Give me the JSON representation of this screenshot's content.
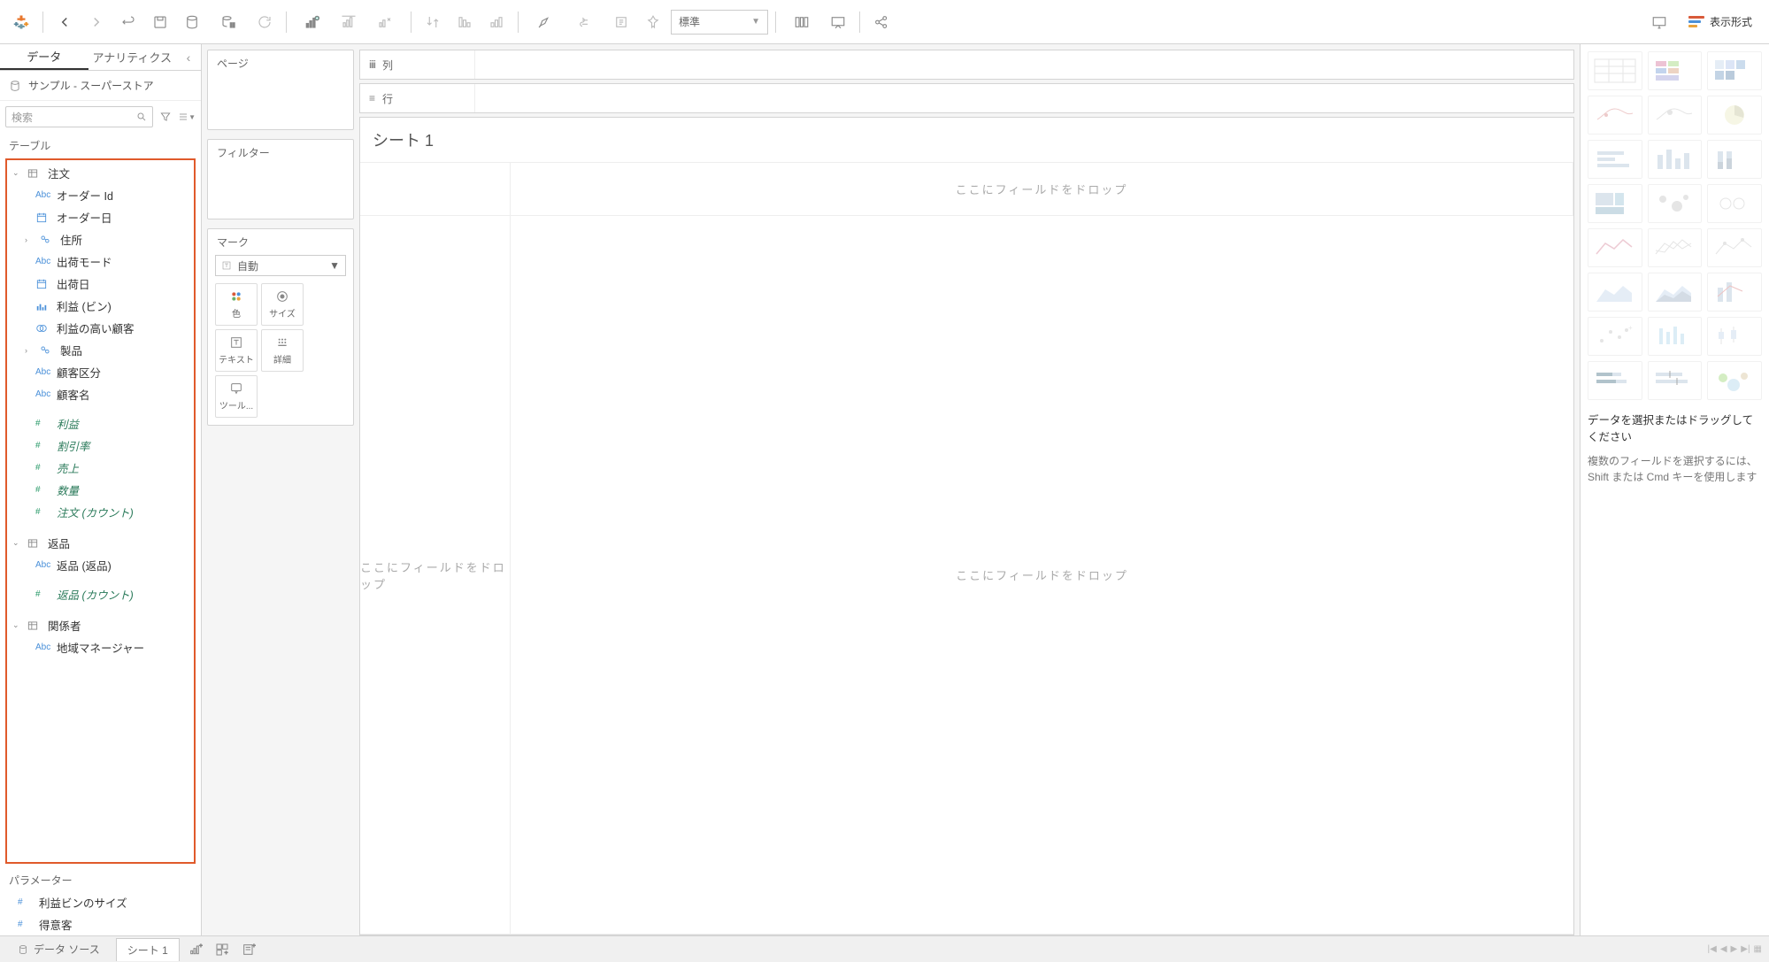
{
  "toolbar": {
    "fit_dropdown": "標準",
    "show_me": "表示形式"
  },
  "data_panel": {
    "tab_data": "データ",
    "tab_analytics": "アナリティクス",
    "datasource": "サンプル - スーパーストア",
    "search_placeholder": "検索",
    "tables_label": "テーブル",
    "tables": [
      {
        "name": "注文",
        "fields": [
          {
            "type": "Abc",
            "label": "オーダー Id"
          },
          {
            "type": "date",
            "label": "オーダー日"
          },
          {
            "type": "geo",
            "label": "住所",
            "expandable": true
          },
          {
            "type": "Abc",
            "label": "出荷モード"
          },
          {
            "type": "date",
            "label": "出荷日"
          },
          {
            "type": "bin",
            "label": "利益 (ビン)"
          },
          {
            "type": "set",
            "label": "利益の高い顧客"
          },
          {
            "type": "geo",
            "label": "製品",
            "expandable": true
          },
          {
            "type": "Abc",
            "label": "顧客区分"
          },
          {
            "type": "Abc",
            "label": "顧客名"
          }
        ],
        "measures": [
          {
            "type": "#",
            "label": "利益"
          },
          {
            "type": "#",
            "label": "割引率"
          },
          {
            "type": "#",
            "label": "売上"
          },
          {
            "type": "#",
            "label": "数量"
          },
          {
            "type": "#",
            "label": "注文 (カウント)",
            "italic": true
          }
        ]
      },
      {
        "name": "返品",
        "fields": [
          {
            "type": "Abc",
            "label": "返品 (返品)"
          }
        ],
        "measures": [
          {
            "type": "#",
            "label": "返品 (カウント)",
            "italic": true
          }
        ]
      },
      {
        "name": "関係者",
        "fields": [
          {
            "type": "Abc",
            "label": "地域マネージャー"
          }
        ],
        "measures": []
      }
    ],
    "parameters_label": "パラメーター",
    "parameters": [
      {
        "type": "#",
        "label": "利益ビンのサイズ"
      },
      {
        "type": "#",
        "label": "得意客"
      }
    ]
  },
  "cards": {
    "pages": "ページ",
    "filters": "フィルター",
    "marks": "マーク",
    "mark_type": "自動",
    "mark_btns": {
      "color": "色",
      "size": "サイズ",
      "text": "テキスト",
      "detail": "詳細",
      "tooltip": "ツール..."
    }
  },
  "shelves": {
    "columns": "列",
    "rows": "行"
  },
  "view": {
    "title": "シート 1",
    "drop_hint": "ここにフィールドをドロップ"
  },
  "show_me": {
    "hint": "データを選択またはドラッグしてください",
    "sub": "複数のフィールドを選択するには、Shift または Cmd キーを使用します"
  },
  "bottom": {
    "datasource": "データ ソース",
    "sheet": "シート 1"
  }
}
